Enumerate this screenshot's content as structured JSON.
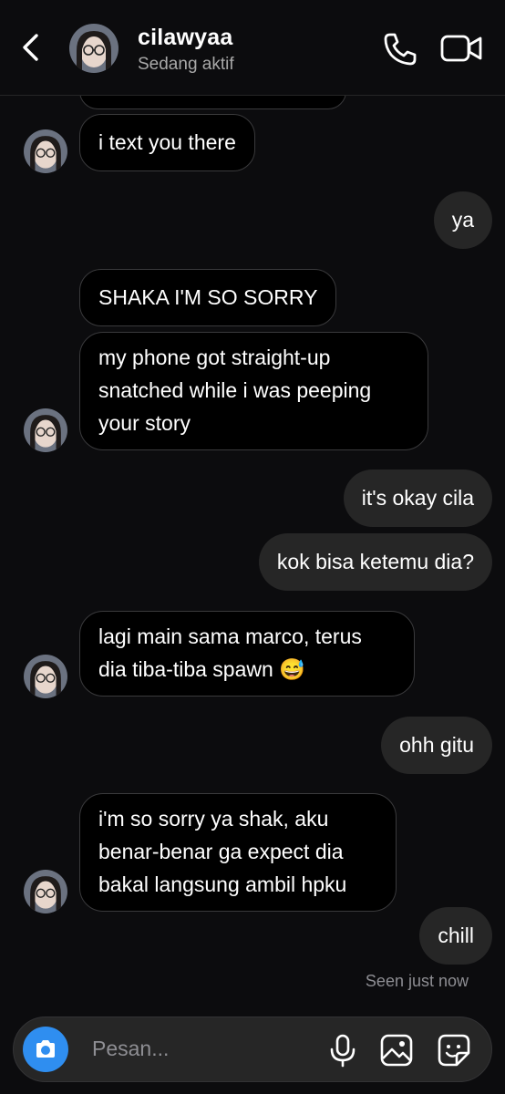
{
  "header": {
    "name": "cilawyaa",
    "status": "Sedang aktif"
  },
  "messages": [
    {
      "side": "in",
      "text": "i text you there"
    },
    {
      "side": "out",
      "text": "ya"
    },
    {
      "side": "in",
      "text": "SHAKA I'M SO SORRY"
    },
    {
      "side": "in",
      "lines": [
        "my phone got straight-up",
        "snatched while i was peeping",
        "your story"
      ]
    },
    {
      "side": "out",
      "text": "it's okay cila"
    },
    {
      "side": "out",
      "text": "kok bisa ketemu dia?"
    },
    {
      "side": "in",
      "lines": [
        "lagi main sama marco, terus",
        "dia tiba-tiba spawn 😅"
      ]
    },
    {
      "side": "out",
      "text": "ohh gitu"
    },
    {
      "side": "in",
      "lines": [
        "i'm so sorry ya shak, aku",
        "benar-benar ga expect dia",
        "bakal langsung ambil hpku"
      ]
    },
    {
      "side": "out",
      "text": "chill"
    }
  ],
  "seen_text": "Seen just now",
  "composer": {
    "placeholder": "Pesan...",
    "icons": [
      "camera-icon",
      "microphone-icon",
      "gallery-icon",
      "sticker-icon"
    ]
  },
  "colors": {
    "background": "#0c0c0e",
    "incoming_bubble": "#000000",
    "outgoing_bubble": "#262626",
    "camera_button": "#2f8ef0"
  }
}
